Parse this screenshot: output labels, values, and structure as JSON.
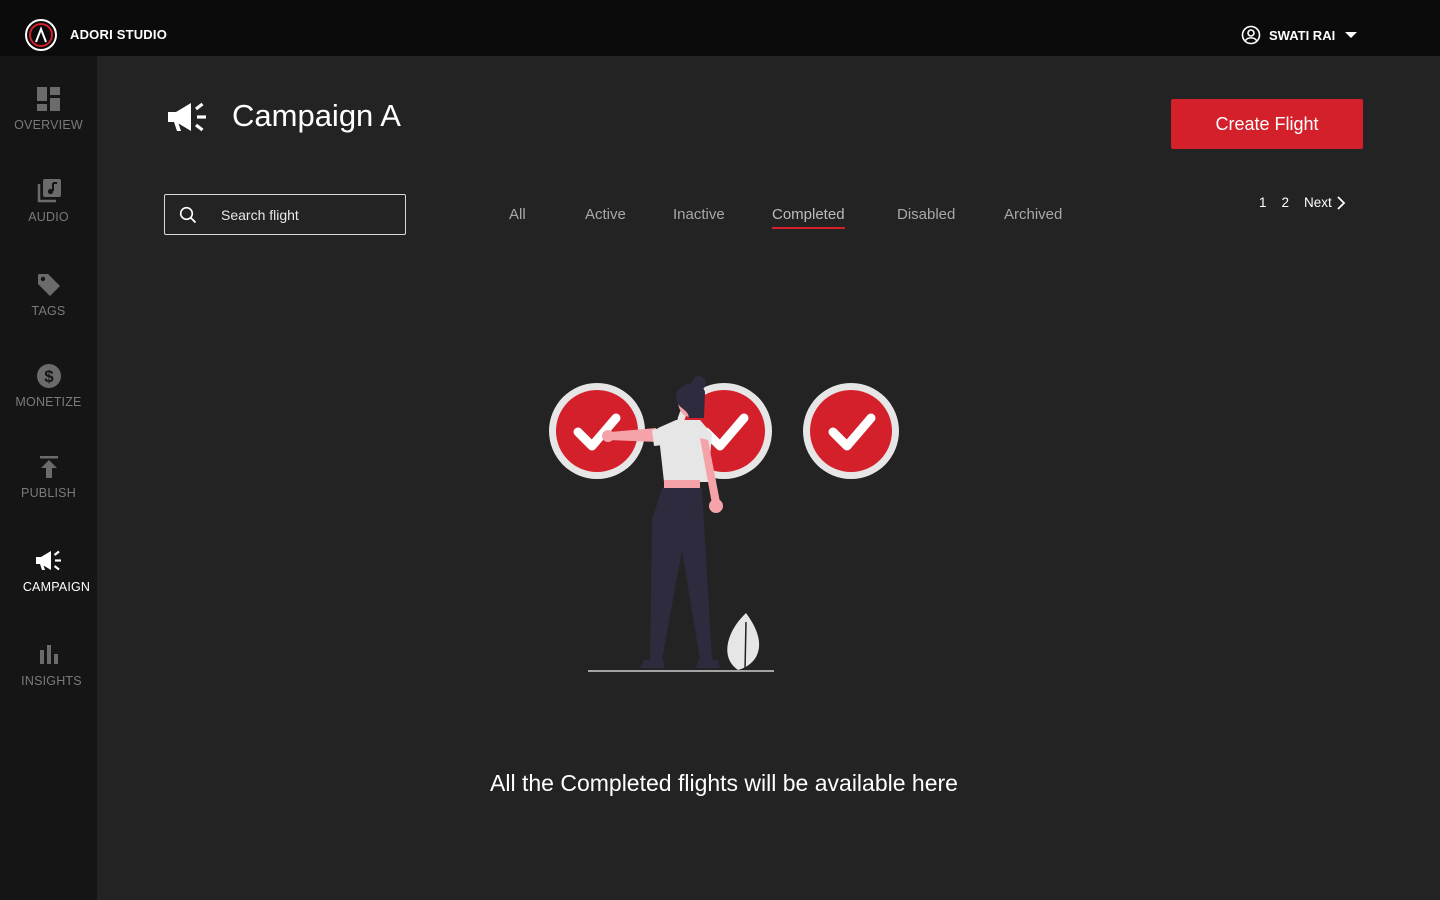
{
  "app": {
    "brand": "ADORI STUDIO"
  },
  "user": {
    "name": "SWATI RAI"
  },
  "sidebar": {
    "items": [
      {
        "label": "OVERVIEW",
        "icon": "dashboard-icon",
        "active": false
      },
      {
        "label": "AUDIO",
        "icon": "audio-library-icon",
        "active": false
      },
      {
        "label": "TAGS",
        "icon": "tag-icon",
        "active": false
      },
      {
        "label": "MONETIZE",
        "icon": "dollar-icon",
        "active": false
      },
      {
        "label": "PUBLISH",
        "icon": "publish-icon",
        "active": false
      },
      {
        "label": "CAMPAIGN",
        "icon": "megaphone-icon",
        "active": true
      },
      {
        "label": "INSIGHTS",
        "icon": "bar-chart-icon",
        "active": false
      }
    ]
  },
  "header": {
    "title": "Campaign A",
    "create_label": "Create Flight"
  },
  "search": {
    "placeholder": "Search flight",
    "value": ""
  },
  "tabs": [
    {
      "label": "All",
      "active": false
    },
    {
      "label": "Active",
      "active": false
    },
    {
      "label": "Inactive",
      "active": false
    },
    {
      "label": "Completed",
      "active": true
    },
    {
      "label": "Disabled",
      "active": false
    },
    {
      "label": "Archived",
      "active": false
    }
  ],
  "pagination": {
    "pages": [
      "1",
      "2"
    ],
    "next_label": "Next"
  },
  "empty_state": {
    "message": "All the Completed flights will be available here"
  },
  "colors": {
    "accent": "#d3202b",
    "background": "#232323",
    "sidebar": "#151515",
    "topbar": "#0b0b0b"
  }
}
